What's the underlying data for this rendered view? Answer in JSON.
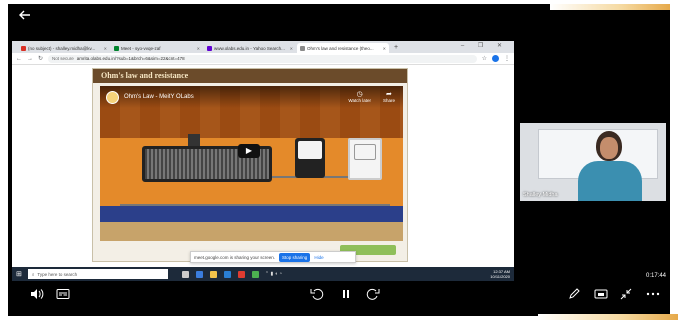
{
  "browser": {
    "tabs": [
      {
        "label": "(no subject) - shalley.midha@kv...",
        "color": "#d93025",
        "active": false
      },
      {
        "label": "Meet - syo-vvqe-zaf",
        "color": "#00832d",
        "active": false
      },
      {
        "label": "www.olabs.edu.in - Yahoo Search...",
        "color": "#6001d2",
        "active": false
      },
      {
        "label": "Ohm's law and resistance (theo...",
        "color": "#8a8a8a",
        "active": true
      }
    ],
    "new_tab": "+",
    "window_controls": "– ❐ ✕",
    "security_label": "Not secure",
    "url": "amrita.olabs.edu.in/?sub=1&brch=6&sim=22&cnt=478"
  },
  "olab": {
    "title": "Ohm's law and resistance",
    "video_title": "Ohm's Law - MeitY OLabs",
    "watch_later": "Watch later",
    "share": "Share"
  },
  "sharing": {
    "message": "meet.google.com is sharing your screen.",
    "stop": "Stop sharing",
    "hide": "Hide"
  },
  "taskbar": {
    "search_placeholder": "Type here to search",
    "time": "12:37 AM",
    "date": "10/11/2020"
  },
  "participant": {
    "name": "Shalley Midha"
  },
  "player": {
    "elapsed": "0:17:44"
  },
  "icons": {
    "back": "arrow-left",
    "volume": "speaker",
    "captions": "subtitles",
    "rewind": "replay-10",
    "pause": "pause",
    "forward": "forward-10",
    "draw": "pencil",
    "cast": "cast",
    "exit_fullscreen": "collapse",
    "more": "ellipsis"
  }
}
